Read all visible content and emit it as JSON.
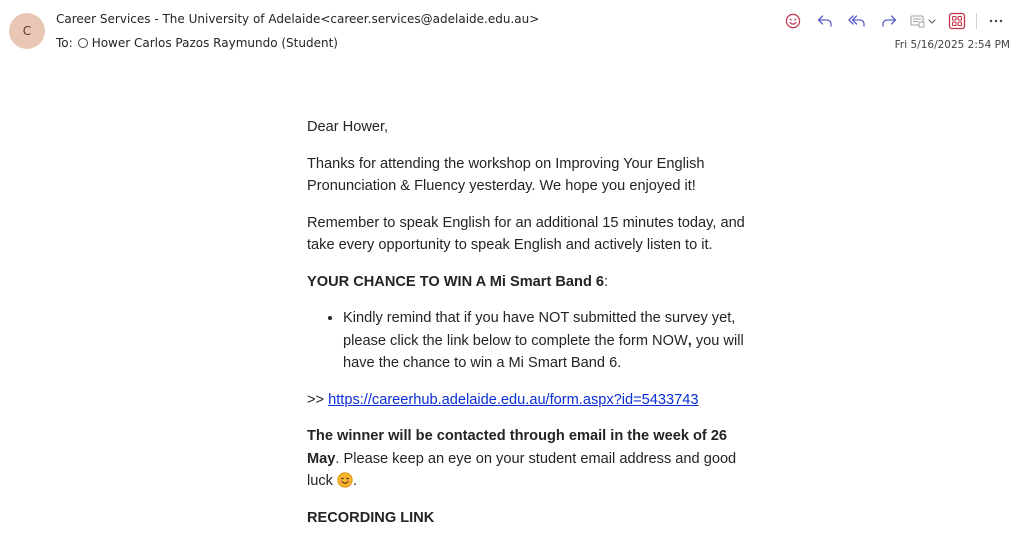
{
  "email": {
    "avatar_initial": "C",
    "from": "Career Services - The University of Adelaide<career.services@adelaide.edu.au>",
    "to_prefix": "To:",
    "to_name": "Hower Carlos Pazos Raymundo (Student)",
    "date": "Fri 5/16/2025 2:54 PM"
  },
  "toolbar": {
    "icons": [
      "emoji-smile-icon",
      "reply-icon",
      "reply-all-icon",
      "forward-icon",
      "apps-dropdown-icon",
      "loop-app-icon",
      "more-options-icon"
    ],
    "accent_color": "#c4314b",
    "reply_color": "#5b5fc7"
  },
  "body": {
    "greeting": "Dear Hower,",
    "para1": "Thanks for attending the workshop on Improving Your English Pronunciation & Fluency yesterday. We hope you enjoyed it!",
    "para2": "Remember to speak English for an additional 15 minutes today, and take every opportunity to speak English and actively listen to it.",
    "chance_heading": "YOUR CHANCE TO WIN A Mi Smart Band 6",
    "chance_colon": ":",
    "bullet_part1": "Kindly remind that if you have NOT submitted the survey yet, please click the link below to complete the form NOW",
    "bullet_comma": ",",
    "bullet_part2": " you will have the chance to win a Mi Smart Band 6.",
    "link_prefix": ">> ",
    "link_text": "https://careerhub.adelaide.edu.au/form.aspx?id=5433743",
    "winner_bold": "The winner will be contacted through email in the week of 26 May",
    "winner_rest": ". Please keep an eye on your student email address and good luck ",
    "winner_end": ".",
    "clipped_heading": "RECORDING LINK"
  }
}
